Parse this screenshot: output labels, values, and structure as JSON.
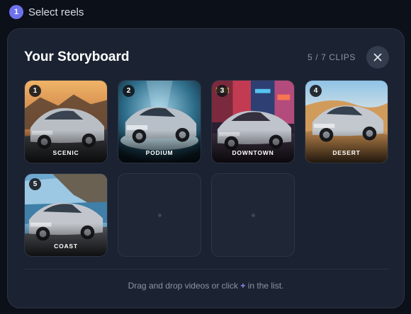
{
  "step": {
    "number": "1",
    "label": "Select reels"
  },
  "storyboard": {
    "title": "Your Storyboard",
    "clip_count": "5 / 7 CLIPS",
    "close_icon": "close-icon"
  },
  "clips": [
    {
      "number": "1",
      "label": "SCENIC",
      "scene": "scenic"
    },
    {
      "number": "2",
      "label": "PODIUM",
      "scene": "podium"
    },
    {
      "number": "3",
      "label": "DOWNTOWN",
      "scene": "downtown"
    },
    {
      "number": "4",
      "label": "DESERT",
      "scene": "desert"
    },
    {
      "number": "5",
      "label": "COAST",
      "scene": "coast"
    }
  ],
  "empty_slots": 2,
  "footer": {
    "before": "Drag and drop videos or click ",
    "plus": "+",
    "after": " in the list."
  }
}
